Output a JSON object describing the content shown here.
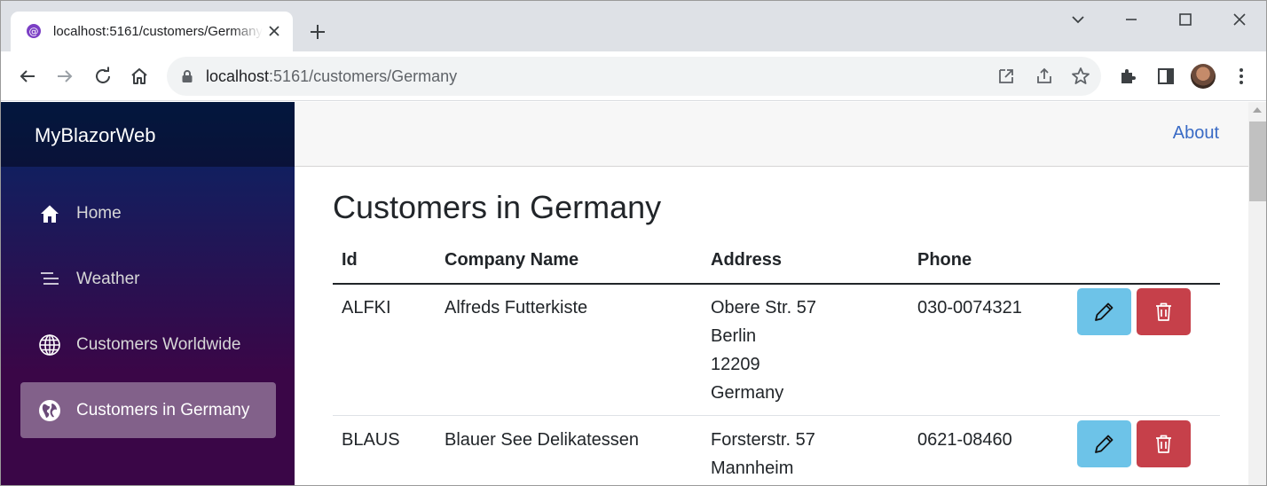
{
  "browser": {
    "tab": {
      "title": "localhost:5161/customers/Germany"
    },
    "address": {
      "host": "localhost",
      "path": ":5161/customers/Germany"
    }
  },
  "app": {
    "brand": "MyBlazorWeb",
    "nav": [
      {
        "label": "Home",
        "icon": "home-icon"
      },
      {
        "label": "Weather",
        "icon": "list-icon"
      },
      {
        "label": "Customers Worldwide",
        "icon": "globe-icon"
      },
      {
        "label": "Customers in Germany",
        "icon": "globe-filled-icon",
        "active": true
      }
    ],
    "top": {
      "about": "About"
    }
  },
  "page": {
    "title": "Customers in Germany",
    "columns": [
      "Id",
      "Company Name",
      "Address",
      "Phone"
    ],
    "rows": [
      {
        "id": "ALFKI",
        "company": "Alfreds Futterkiste",
        "address": [
          "Obere Str. 57",
          "Berlin",
          "12209",
          "Germany"
        ],
        "phone": "030-0074321"
      },
      {
        "id": "BLAUS",
        "company": "Blauer See Delikatessen",
        "address": [
          "Forsterstr. 57",
          "Mannheim"
        ],
        "phone": "0621-08460"
      }
    ]
  },
  "colors": {
    "edit_button": "#6dc3e8",
    "delete_button": "#c6404a",
    "link": "#3a6bc5",
    "active_nav": "rgba(255,255,255,0.37)"
  }
}
